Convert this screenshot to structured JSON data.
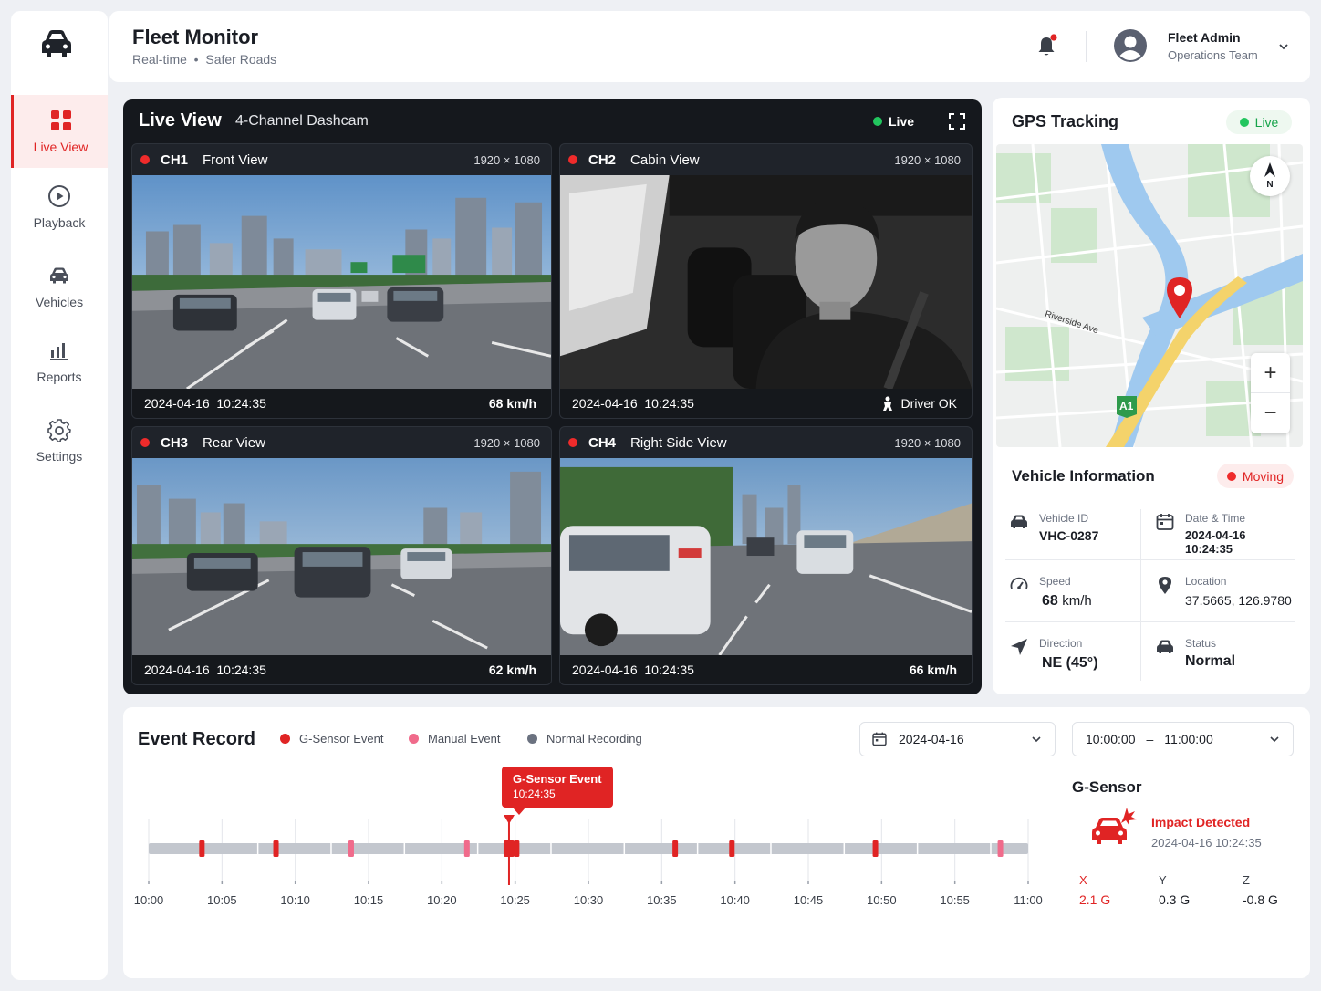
{
  "nav": [
    {
      "label": "Live View",
      "icon": "grid-icon",
      "active": true
    },
    {
      "label": "Playback",
      "icon": "play-circle-icon"
    },
    {
      "label": "Vehicles",
      "icon": "car-icon"
    },
    {
      "label": "Reports",
      "icon": "bar-chart-icon"
    },
    {
      "label": "Settings",
      "icon": "gear-icon"
    }
  ],
  "header": {
    "title": "Fleet Monitor",
    "subtitle": "Real-time  •  Safer Roads",
    "user_name": "Fleet Admin",
    "user_team": "Operations Team"
  },
  "live_view": {
    "title": "Live View",
    "subtitle": "4-Channel Dashcam",
    "status": "Live",
    "cameras": [
      {
        "channel": "CH1",
        "name": "Front View",
        "resolution": "1920 × 1080",
        "timestamp": "2024-04-16  10:24:35",
        "info": "68 km/h"
      },
      {
        "channel": "CH2",
        "name": "Cabin View",
        "resolution": "1920 × 1080",
        "timestamp": "2024-04-16  10:24:35",
        "info": "Driver OK"
      },
      {
        "channel": "CH3",
        "name": "Rear View",
        "resolution": "1920 × 1080",
        "timestamp": "2024-04-16  10:24:35",
        "info": "62 km/h"
      },
      {
        "channel": "CH4",
        "name": "Right Side View",
        "resolution": "1920 × 1080",
        "timestamp": "2024-04-16  10:24:35",
        "info": "66 km/h"
      }
    ]
  },
  "gps": {
    "title": "GPS Tracking",
    "status": "Live",
    "map_labels": {
      "street": "Riverside Ave",
      "highway": "A1",
      "compass": "N",
      "zoom_in": "+",
      "zoom_out": "−"
    }
  },
  "vehicle_info": {
    "title": "Vehicle Information",
    "status_badge": "Moving",
    "vehicle_id_label": "Vehicle ID",
    "vehicle_id": "VHC-0287",
    "datetime_label": "Date & Time",
    "datetime": "2024-04-16 10:24:35",
    "speed_label": "Speed",
    "speed_value": "68",
    "speed_unit": "km/h",
    "location_label": "Location",
    "location": "37.5665, 126.9780",
    "direction_label": "Direction",
    "direction": "NE (45°)",
    "status_label": "Status",
    "status": "Normal"
  },
  "event_record": {
    "title": "Event Record",
    "legend": [
      {
        "label": "G-Sensor Event",
        "color": "#e02424"
      },
      {
        "label": "Manual Event",
        "color": "#f06b8b"
      },
      {
        "label": "Normal Recording",
        "color": "#6b7280"
      }
    ],
    "date": "2024-04-16",
    "time_start": "10:00:00",
    "time_sep": "–",
    "time_end": "11:00:00",
    "ticks": [
      "10:00",
      "10:05",
      "10:10",
      "10:15",
      "10:20",
      "10:25",
      "10:30",
      "10:35",
      "10:40",
      "10:45",
      "10:50",
      "10:55",
      "11:00"
    ],
    "callout_title": "G-Sensor Event",
    "callout_time": "10:24:35",
    "events_minutes": [
      {
        "t": 4.6,
        "type": "gsensor"
      },
      {
        "t": 11.0,
        "type": "gsensor"
      },
      {
        "t": 17.5,
        "type": "manual"
      },
      {
        "t": 27.5,
        "type": "manual"
      },
      {
        "t": 31.8,
        "type": "gsensor"
      },
      {
        "t": 45.5,
        "type": "gsensor"
      },
      {
        "t": 50.4,
        "type": "gsensor"
      },
      {
        "t": 62.8,
        "type": "gsensor"
      },
      {
        "t": 73.6,
        "type": "manual"
      }
    ]
  },
  "gsensor": {
    "title": "G-Sensor",
    "impact": "Impact Detected",
    "timestamp": "2024-04-16 10:24:35",
    "x_label": "X",
    "x_value": "2.1 G",
    "y_label": "Y",
    "y_value": "0.3 G",
    "z_label": "Z",
    "z_value": "-0.8 G"
  }
}
